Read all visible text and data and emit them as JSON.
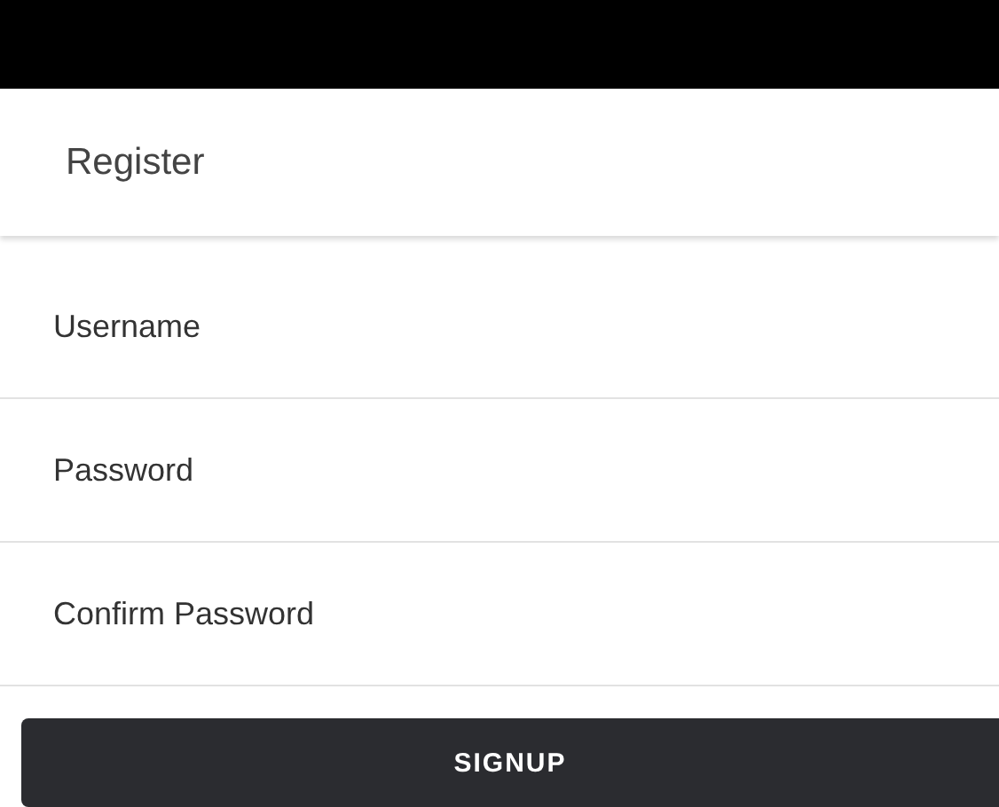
{
  "header": {
    "title": "Register"
  },
  "fields": [
    {
      "placeholder": "Username"
    },
    {
      "placeholder": "Password"
    },
    {
      "placeholder": "Confirm Password"
    }
  ],
  "button": {
    "label": "SIGNUP"
  }
}
